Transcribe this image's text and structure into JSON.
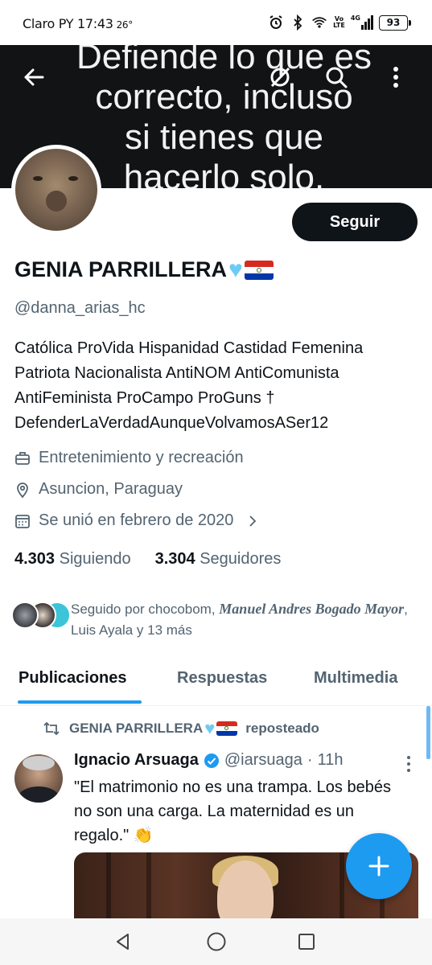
{
  "status_bar": {
    "carrier_time": "Claro PY 17:43",
    "temperature": "26°",
    "network_top": "Vo",
    "network_bottom": "LTE",
    "signal_type": "4G",
    "battery": "93",
    "icons": [
      "alarm-icon",
      "bluetooth-icon",
      "wifi-icon",
      "signal-icon"
    ]
  },
  "banner": {
    "line1": "Defiende lo que es",
    "line2": "correcto, incluso",
    "line3": "si tienes que",
    "line4": "hacerlo solo.",
    "icons": [
      "back-arrow-icon",
      "grok-icon",
      "search-icon",
      "more-vertical-icon"
    ]
  },
  "profile": {
    "follow_label": "Seguir",
    "name": "GENIA PARRILLERA",
    "handle": "@danna_arias_hc",
    "bio_lines": [
      "Católica ProVida Hispanidad Castidad Femenina",
      "Patriota Nacionalista AntiNOM AntiComunista",
      "AntiFeminista ProCampo ProGuns †",
      "DefenderLaVerdadAunqueVolvamosASer12"
    ],
    "category": "Entretenimiento y recreación",
    "location": "Asuncion, Paraguay",
    "joined": "Se unió en febrero de 2020",
    "following_count": "4.303",
    "following_label": "Siguiendo",
    "followers_count": "3.304",
    "followers_label": "Seguidores",
    "followed_by_prefix": "Seguido por chocobom,",
    "followed_by_name": "Manuel Andres Bogado Mayor",
    "followed_by_suffix": ", Luis Ayala y 13 más"
  },
  "tabs": [
    {
      "label": "Publicaciones",
      "active": true
    },
    {
      "label": "Respuestas",
      "active": false
    },
    {
      "label": "Multimedia",
      "active": false
    }
  ],
  "post": {
    "repost_name": "GENIA PARRILLERA",
    "repost_label": "reposteado",
    "author": "Ignacio Arsuaga",
    "handle": "@iarsuaga",
    "separator": "·",
    "time": "11h",
    "text": "\"El matrimonio no es una trampa. Los bebés no son una carga. La maternidad es un regalo.\" 👏"
  },
  "colors": {
    "accent": "#1d9bf0",
    "text": "#0f1419",
    "muted": "#536471",
    "heart": "#6ecbf5"
  },
  "compose_icon": "plus-icon",
  "navbar_icons": [
    "back-triangle-icon",
    "home-circle-icon",
    "recents-square-icon"
  ]
}
